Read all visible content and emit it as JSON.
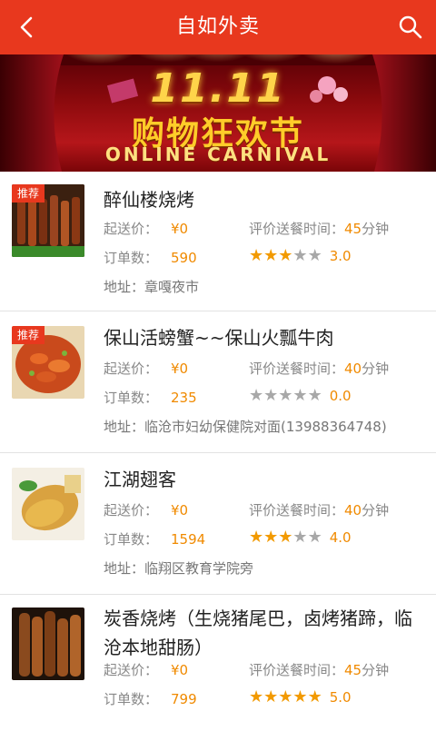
{
  "header": {
    "title": "自如外卖",
    "back_icon": "chevron-left-icon",
    "search_icon": "search-icon"
  },
  "banner": {
    "headline": "11.11",
    "subtitle": "购物狂欢节",
    "english": "ONLINE CARNIVAL"
  },
  "labels": {
    "min_price": "起送价：",
    "delivery_time": "评价送餐时间：",
    "orders": "订单数：",
    "address": "地址：",
    "minutes": "分钟"
  },
  "restaurants": [
    {
      "tag": "推荐",
      "name": "醉仙楼烧烤",
      "min_price": "¥0",
      "delivery_minutes": "45",
      "orders": "590",
      "rating": 3,
      "rating_text": "3.0",
      "address": "章嘎夜市"
    },
    {
      "tag": "推荐",
      "name": "保山活螃蟹~~保山火瓢牛肉",
      "min_price": "¥0",
      "delivery_minutes": "40",
      "orders": "235",
      "rating": 0,
      "rating_text": "0.0",
      "address": "临沧市妇幼保健院对面(13988364748)"
    },
    {
      "tag": "",
      "name": "江湖翅客",
      "min_price": "¥0",
      "delivery_minutes": "40",
      "orders": "1594",
      "rating": 3,
      "rating_text": "4.0",
      "address": "临翔区教育学院旁"
    },
    {
      "tag": "",
      "name": "炭香烧烤（生烧猪尾巴，卤烤猪蹄，临沧本地甜肠）",
      "min_price": "¥0",
      "delivery_minutes": "45",
      "orders": "799",
      "rating": 5,
      "rating_text": "5.0",
      "address": ""
    }
  ],
  "colors": {
    "brand": "#e8381e",
    "accent": "#f08a00",
    "star_on": "#f29a00",
    "star_off": "#a8a8a8"
  }
}
